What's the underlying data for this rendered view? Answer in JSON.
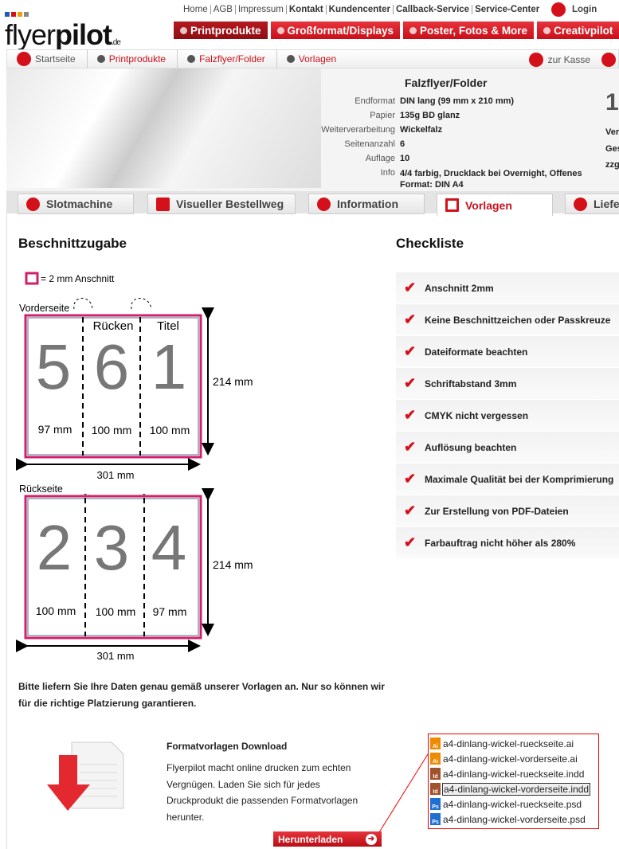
{
  "header": {
    "logo": "flyerpilot",
    "logo_suffix": ".de",
    "top_links": [
      "Home",
      "AGB",
      "Impressum",
      "Kontakt",
      "Kundencenter",
      "Callback-Service",
      "Service-Center"
    ],
    "login": "Login",
    "nav": [
      "Printprodukte",
      "Großformat/Displays",
      "Poster, Fotos & More",
      "Creativpilot"
    ]
  },
  "breadcrumb": [
    "Startseite",
    "Printprodukte",
    "Falzflyer/Folder",
    "Vorlagen"
  ],
  "cart": "zur Kasse",
  "product": {
    "title": "Falzflyer/Folder",
    "specs": [
      {
        "k": "Endformat",
        "v": "DIN lang (99 mm x 210 mm)"
      },
      {
        "k": "Papier",
        "v": "135g BD glanz"
      },
      {
        "k": "Weiterverarbeitung",
        "v": "Wickelfalz"
      },
      {
        "k": "Seitenanzahl",
        "v": "6"
      },
      {
        "k": "Auflage",
        "v": "10"
      },
      {
        "k": "Info",
        "v": "4/4 farbig, Drucklack bei Overnight, Offenes Format: DIN A4"
      }
    ],
    "price_partial": "1",
    "side_partial": [
      "Ver",
      "Ges",
      "zzg"
    ]
  },
  "tabs": [
    "Slotmachine",
    "Visueller Bestellweg",
    "Information",
    "Vorlagen",
    "Liefe"
  ],
  "left": {
    "title": "Beschnittzugabe",
    "legend": "= 2 mm Anschnitt",
    "front": {
      "label": "Vorderseite",
      "pages": [
        "5",
        "6",
        "1"
      ],
      "panel_labels": [
        "",
        "Rücken",
        "Titel"
      ],
      "widths": [
        "97 mm",
        "100 mm",
        "100 mm"
      ],
      "height": "214 mm",
      "total": "301 mm"
    },
    "back": {
      "label": "Rückseite",
      "pages": [
        "2",
        "3",
        "4"
      ],
      "widths": [
        "100 mm",
        "100 mm",
        "97 mm"
      ],
      "height": "214 mm",
      "total": "301 mm"
    },
    "note": "Bitte liefern Sie Ihre Daten genau gemäß unserer Vorlagen an. Nur so können wir für die richtige Platzierung garantieren."
  },
  "checklist": {
    "title": "Checkliste",
    "items": [
      "Anschnitt 2mm",
      "Keine Beschnittzeichen oder Passkreuze",
      "Dateiformate beachten",
      "Schriftabstand 3mm",
      "CMYK nicht vergessen",
      "Auflösung beachten",
      "Maximale Qualität bei der Komprimierung",
      "Zur Erstellung von PDF-Dateien",
      "Farbauftrag nicht höher als 280%"
    ]
  },
  "download": {
    "title": "Formatvorlagen Download",
    "text": "Flyerpilot macht online drucken zum echten Vergnügen. Laden Sie sich für jedes Druckprodukt die passenden Formatvorlagen herunter.",
    "button": "Herunterladen",
    "files": [
      {
        "name": "a4-dinlang-wickel-rueckseite.ai",
        "type": "Ai",
        "color": "#f08a00"
      },
      {
        "name": "a4-dinlang-wickel-vorderseite.ai",
        "type": "Ai",
        "color": "#f08a00"
      },
      {
        "name": "a4-dinlang-wickel-rueckseite.indd",
        "type": "Id",
        "color": "#a0522d"
      },
      {
        "name": "a4-dinlang-wickel-vorderseite.indd",
        "type": "Id",
        "color": "#a0522d"
      },
      {
        "name": "a4-dinlang-wickel-rueckseite.psd",
        "type": "Ps",
        "color": "#1e6fd0"
      },
      {
        "name": "a4-dinlang-wickel-vorderseite.psd",
        "type": "Ps",
        "color": "#1e6fd0"
      }
    ]
  },
  "colors": {
    "brand": "#d4111b",
    "bleed": "#d0206a"
  }
}
